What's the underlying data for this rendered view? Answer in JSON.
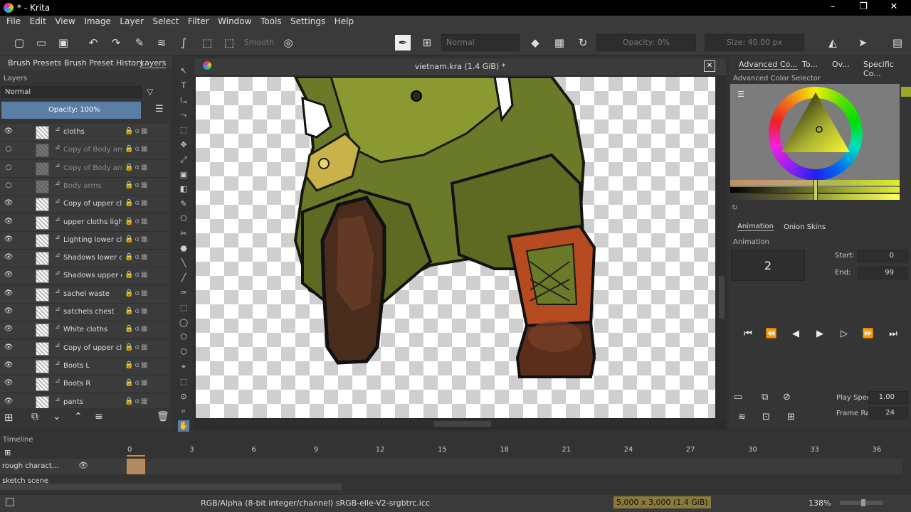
{
  "window": {
    "title": "* - Krita",
    "minimize": "–",
    "restore": "❐",
    "close": "✕"
  },
  "menu": [
    "File",
    "Edit",
    "View",
    "Image",
    "Layer",
    "Select",
    "Filter",
    "Window",
    "Tools",
    "Settings",
    "Help"
  ],
  "toolbar": {
    "smooth_label": "Smooth",
    "blend_mode": "Normal",
    "opacity": "Opacity: 0%",
    "size": "Size: 40.00 px"
  },
  "left_tabs": [
    "Brush Presets",
    "Brush Preset History",
    "Layers"
  ],
  "layers_panel": {
    "header": "Layers",
    "blend_mode": "Normal",
    "opacity": "Opacity:  100%",
    "layers": [
      {
        "name": "cloths",
        "visible": true
      },
      {
        "name": "Copy of Body arms",
        "visible": false
      },
      {
        "name": "Copy of Body arms",
        "visible": false
      },
      {
        "name": "Body arms",
        "visible": false
      },
      {
        "name": "Copy of upper cl...",
        "visible": true
      },
      {
        "name": "upper cloths light...",
        "visible": true
      },
      {
        "name": "Lighting lower cl...",
        "visible": true
      },
      {
        "name": "Shadows lower cl...",
        "visible": true
      },
      {
        "name": "Shadows upper c...",
        "visible": true
      },
      {
        "name": "sachel waste",
        "visible": true
      },
      {
        "name": "satchels chest",
        "visible": true
      },
      {
        "name": "White cloths",
        "visible": true
      },
      {
        "name": "Copy of upper cl...",
        "visible": true
      },
      {
        "name": "Boots L",
        "visible": true
      },
      {
        "name": "Boots R",
        "visible": true
      },
      {
        "name": "pants",
        "visible": true
      }
    ]
  },
  "canvas": {
    "doc_title": "vietnam.kra (1.4 GiB) *"
  },
  "right_tabs": [
    "Advanced Co...",
    "To...",
    "Ov...",
    "Specific Co..."
  ],
  "color_selector": {
    "header": "Advanced Color Selector",
    "fg_color": "#9aa826"
  },
  "animation": {
    "tabs": [
      "Animation",
      "Onion Skins"
    ],
    "header": "Animation",
    "current_frame": "2",
    "start_label": "Start:",
    "start_value": "0",
    "end_label": "End:",
    "end_value": "99",
    "play_speed_label": "Play Speed:",
    "play_speed_value": "1.00",
    "frame_rate_label": "Frame Rate:",
    "frame_rate_value": "24"
  },
  "timeline": {
    "header": "Timeline",
    "frames": [
      "0",
      "3",
      "6",
      "9",
      "12",
      "15",
      "18",
      "21",
      "24",
      "27",
      "30",
      "33",
      "36"
    ],
    "rows": [
      "rough charact...",
      "sketch scene"
    ]
  },
  "status": {
    "color_space": "RGB/Alpha (8-bit integer/channel)  sRGB-elle-V2-srgbtrc.icc",
    "dimensions": "5,000 x 3,000 (1.4 GiB)",
    "zoom": "138%"
  }
}
